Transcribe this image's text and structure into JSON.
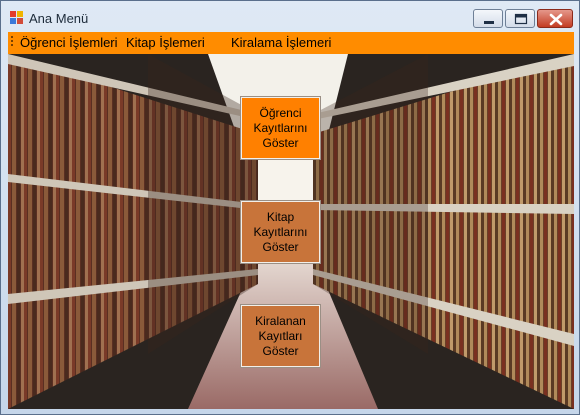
{
  "window": {
    "title": "Ana Menü"
  },
  "menu": {
    "items": [
      {
        "label": "Öğrenci İşlemleri"
      },
      {
        "label": "Kitap İşlemeri"
      },
      {
        "label": "Kiralama İşlemeri"
      }
    ]
  },
  "buttons": {
    "students": "Öğrenci\nKayıtlarını\nGöster",
    "books": "Kitap\nKayıtlarını\nGöster",
    "rentals": "Kiralanan\nKayıtları\nGöster"
  },
  "colors": {
    "menu_bar": "#ff8c00",
    "button_active": "#ff8000",
    "button": "#c8743a"
  },
  "icons": [
    "app-icon",
    "minimize-icon",
    "maximize-icon",
    "close-icon",
    "menu-grip-icon"
  ]
}
